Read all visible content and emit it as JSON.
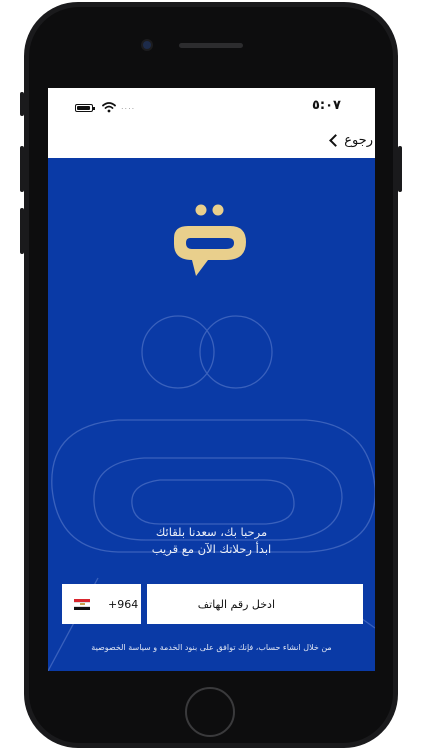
{
  "status_bar": {
    "time": "٥:٠٧",
    "signal_text": "....",
    "battery_icon": "battery-icon",
    "wifi_icon": "wifi-icon"
  },
  "nav": {
    "back_label": "رجوع",
    "back_icon": "chevron-left-icon"
  },
  "brand": {
    "logo_icon": "chat-bubble-logo",
    "logo_color": "#e9cf8c",
    "background_color": "#0a3aa6"
  },
  "welcome": {
    "line1": "مرحبا بك، سعدنا بلقائك",
    "line2": "ابدأ رحلاتك الآن مع قريب"
  },
  "phone_input": {
    "country_code": "+964",
    "country_flag": "iraq-flag-icon",
    "placeholder": "ادخل رقم الهاتف"
  },
  "terms": {
    "text": "من خلال انشاء حساب، فإنك توافق على بنود الخدمة و سياسة الخصوصية"
  }
}
